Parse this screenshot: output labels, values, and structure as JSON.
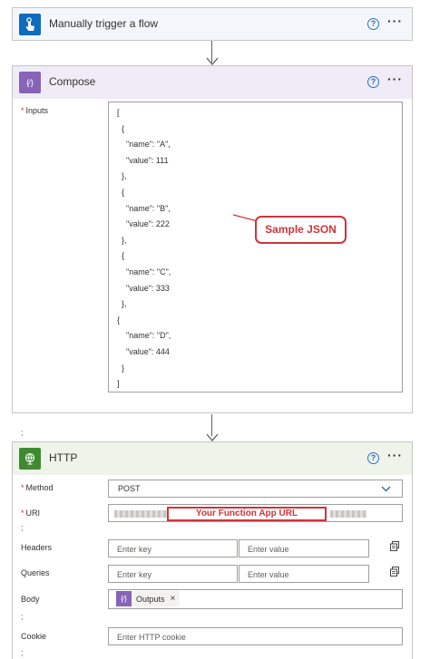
{
  "trigger": {
    "title": "Manually trigger a flow",
    "help": "?",
    "more": "···",
    "color": "#0f6cbd"
  },
  "compose": {
    "title": "Compose",
    "help": "?",
    "more": "···",
    "color": "#8764b8",
    "icon_glyph": "{⁄}",
    "inputs_label": "Inputs",
    "required_mark": "*",
    "semicolon": ";",
    "json_lines": [
      "[",
      "  {",
      "    \"name\": \"A\",",
      "    \"value\": 111",
      "  },",
      "  {",
      "    \"name\": \"B\",",
      "    \"value\": 222",
      "  },",
      "  {",
      "    \"name\": \"C\",",
      "    \"value\": 333",
      "  },",
      "{",
      "    \"name\": \"D\",",
      "    \"value\": 444",
      "  }",
      "]"
    ],
    "annotation": "Sample JSON"
  },
  "http": {
    "title": "HTTP",
    "help": "?",
    "more": "···",
    "color": "#3f8a30",
    "method_label": "Method",
    "method_value": "POST",
    "uri_label": "URI",
    "uri_annotation": "Your Function App URL",
    "headers_label": "Headers",
    "headers_key_placeholder": "Enter key",
    "headers_value_placeholder": "Enter value",
    "queries_label": "Queries",
    "queries_key_placeholder": "Enter key",
    "queries_value_placeholder": "Enter value",
    "body_label": "Body",
    "body_token": "Outputs",
    "body_token_remove": "×",
    "cookie_label": "Cookie",
    "cookie_placeholder": "Enter HTTP cookie",
    "required_mark": "*",
    "semicolon": ";"
  }
}
